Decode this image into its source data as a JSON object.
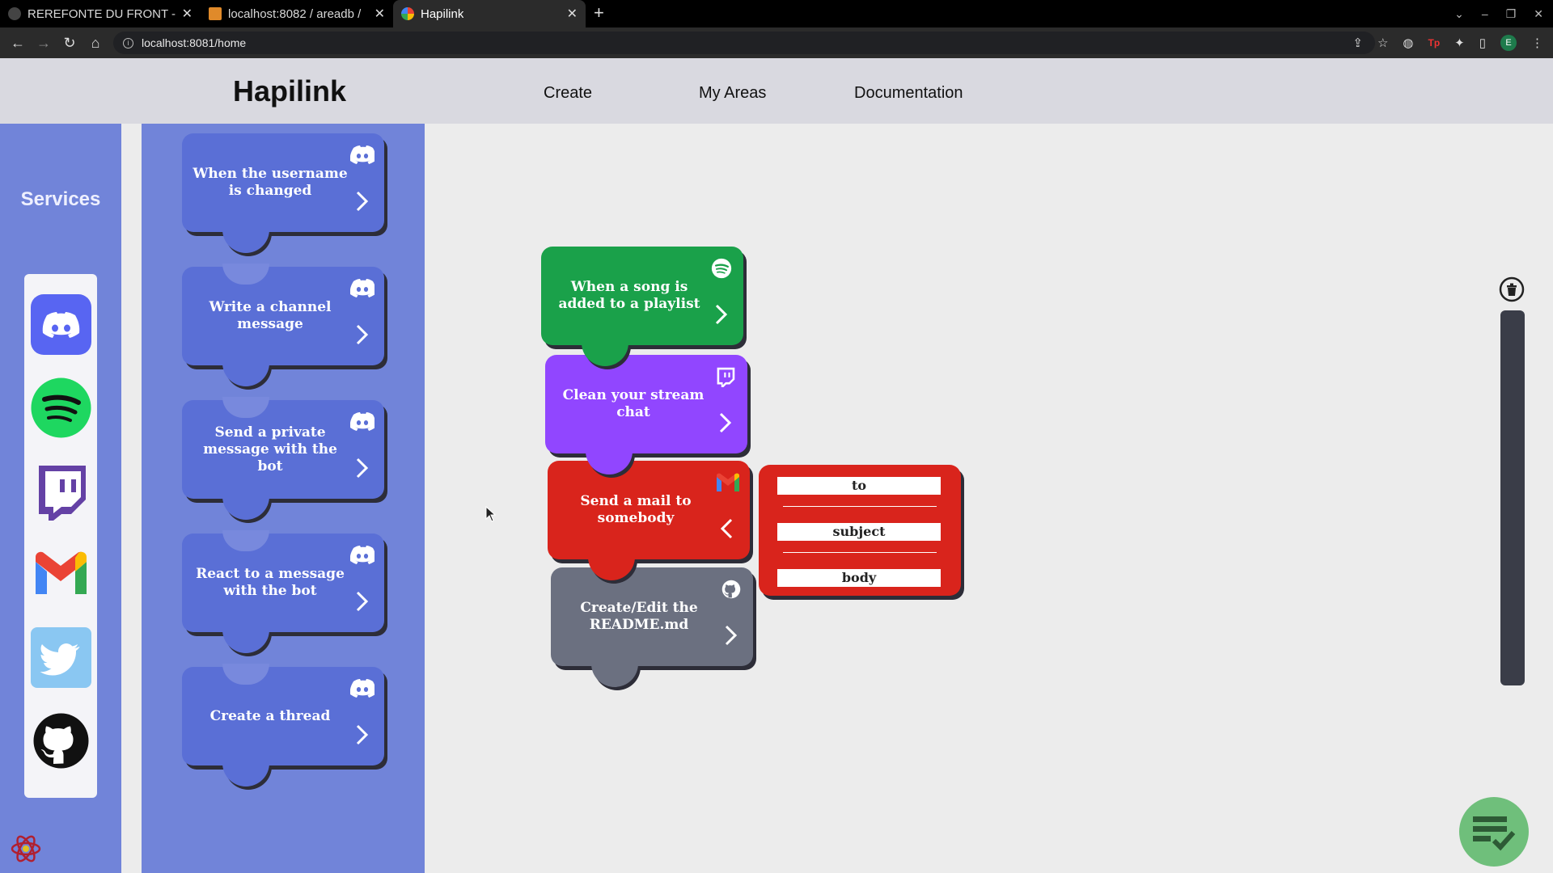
{
  "browser": {
    "tabs": [
      {
        "title": "REREFONTE DU FRONT - ",
        "icon": "github-icon",
        "active": false
      },
      {
        "title": "localhost:8082 / areadb / ",
        "icon": "phpmyadmin-icon",
        "active": false
      },
      {
        "title": "Hapilink",
        "icon": "google-icon",
        "active": true
      }
    ],
    "url": "localhost:8081/home"
  },
  "header": {
    "brand": "Hapilink",
    "nav": [
      "Create",
      "My Areas",
      "Documentation"
    ]
  },
  "sidebar": {
    "title": "Services",
    "services": [
      "discord-icon",
      "spotify-icon",
      "twitch-icon",
      "gmail-icon",
      "twitter-icon",
      "github-icon"
    ]
  },
  "actions_list": [
    {
      "label": "When the username is changed",
      "service": "discord-icon"
    },
    {
      "label": "Write a channel message",
      "service": "discord-icon"
    },
    {
      "label": "Send a private message with the bot",
      "service": "discord-icon"
    },
    {
      "label": "React to a message with the bot",
      "service": "discord-icon"
    },
    {
      "label": "Create a thread",
      "service": "discord-icon"
    }
  ],
  "workspace": {
    "blocks": [
      {
        "label": "When a song is added to a playlist",
        "service": "spotify-icon",
        "color": "#1aa14a"
      },
      {
        "label": "Clean your stream chat",
        "service": "twitch-icon",
        "color": "#9146ff"
      },
      {
        "label": "Send a mail to somebody",
        "service": "gmail-icon",
        "color": "#d9241c"
      },
      {
        "label": "Create/Edit the README.md",
        "service": "github-icon",
        "color": "#6b7080"
      }
    ],
    "mail_params": [
      "to",
      "subject",
      "body"
    ]
  }
}
